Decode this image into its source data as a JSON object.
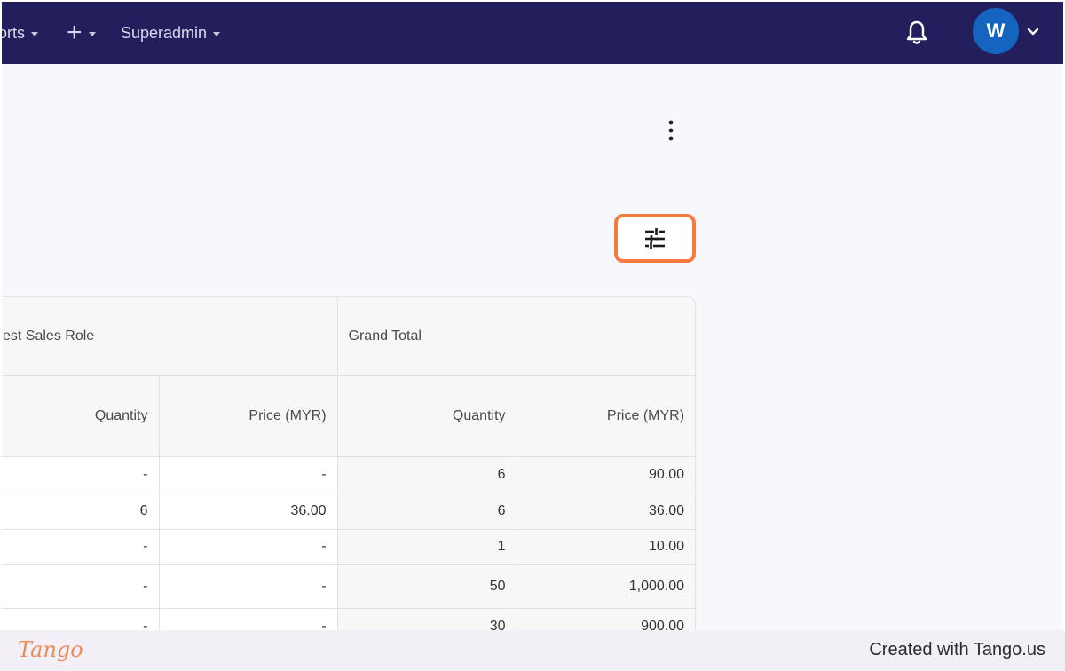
{
  "navbar": {
    "reports_label": "orts",
    "superadmin_label": "Superadmin",
    "avatar_initial": "W",
    "add_icon": "plus-icon",
    "bell_icon": "bell-icon"
  },
  "table": {
    "group_headers": [
      "est Sales Role",
      "Grand Total"
    ],
    "sub_headers": [
      "Quantity",
      "Price (MYR)",
      "Quantity",
      "Price (MYR)"
    ],
    "rows": [
      [
        "-",
        "-",
        "6",
        "90.00"
      ],
      [
        "6",
        "36.00",
        "6",
        "36.00"
      ],
      [
        "-",
        "-",
        "1",
        "10.00"
      ],
      [
        "-",
        "-",
        "50",
        "1,000.00"
      ],
      [
        "-",
        "-",
        "30",
        "900.00"
      ]
    ]
  },
  "footer": {
    "logo_text": "Tango",
    "created_text": "Created with Tango.us"
  },
  "colors": {
    "navbar": "#231f5c",
    "avatar": "#1565c0",
    "highlight": "#f47a42",
    "footer_bg": "#f2eff6"
  }
}
